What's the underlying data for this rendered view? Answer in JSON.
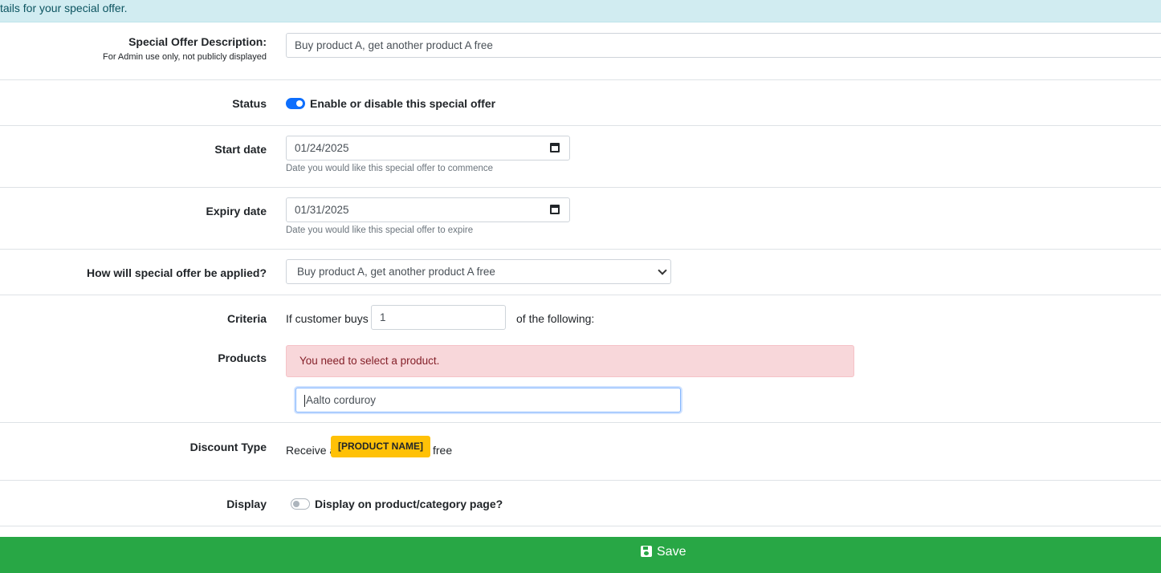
{
  "banner": {
    "text": "tails for your special offer."
  },
  "description": {
    "label": "Special Offer Description:",
    "sublabel": "For Admin use only, not publicly displayed",
    "value": "Buy product A, get another product A free"
  },
  "status": {
    "label": "Status",
    "toggle_label": "Enable or disable this special offer",
    "enabled": true
  },
  "start_date": {
    "label": "Start date",
    "value": "01/24/2025",
    "help": "Date you would like this special offer to commence"
  },
  "expiry_date": {
    "label": "Expiry date",
    "value": "01/31/2025",
    "help": "Date you would like this special offer to expire"
  },
  "application": {
    "label": "How will special offer be applied?",
    "selected": "Buy product A, get another product A free"
  },
  "criteria": {
    "label": "Criteria",
    "prefix": "If customer buys",
    "quantity": "1",
    "suffix": "of the following:"
  },
  "products": {
    "label": "Products",
    "alert": "You need to select a product.",
    "search_value": "Aalto corduroy"
  },
  "discount": {
    "label": "Discount Type",
    "prefix": "Receive a",
    "badge": "[PRODUCT NAME]",
    "suffix": "free"
  },
  "display": {
    "label": "Display",
    "toggle_label": "Display on product/category page?",
    "enabled": false
  },
  "save": {
    "label": "Save"
  },
  "colors": {
    "primary": "#0d6efd",
    "success": "#28a745",
    "warning": "#ffc107",
    "danger_bg": "#f8d7da",
    "info_bg": "#d1ecf1"
  }
}
